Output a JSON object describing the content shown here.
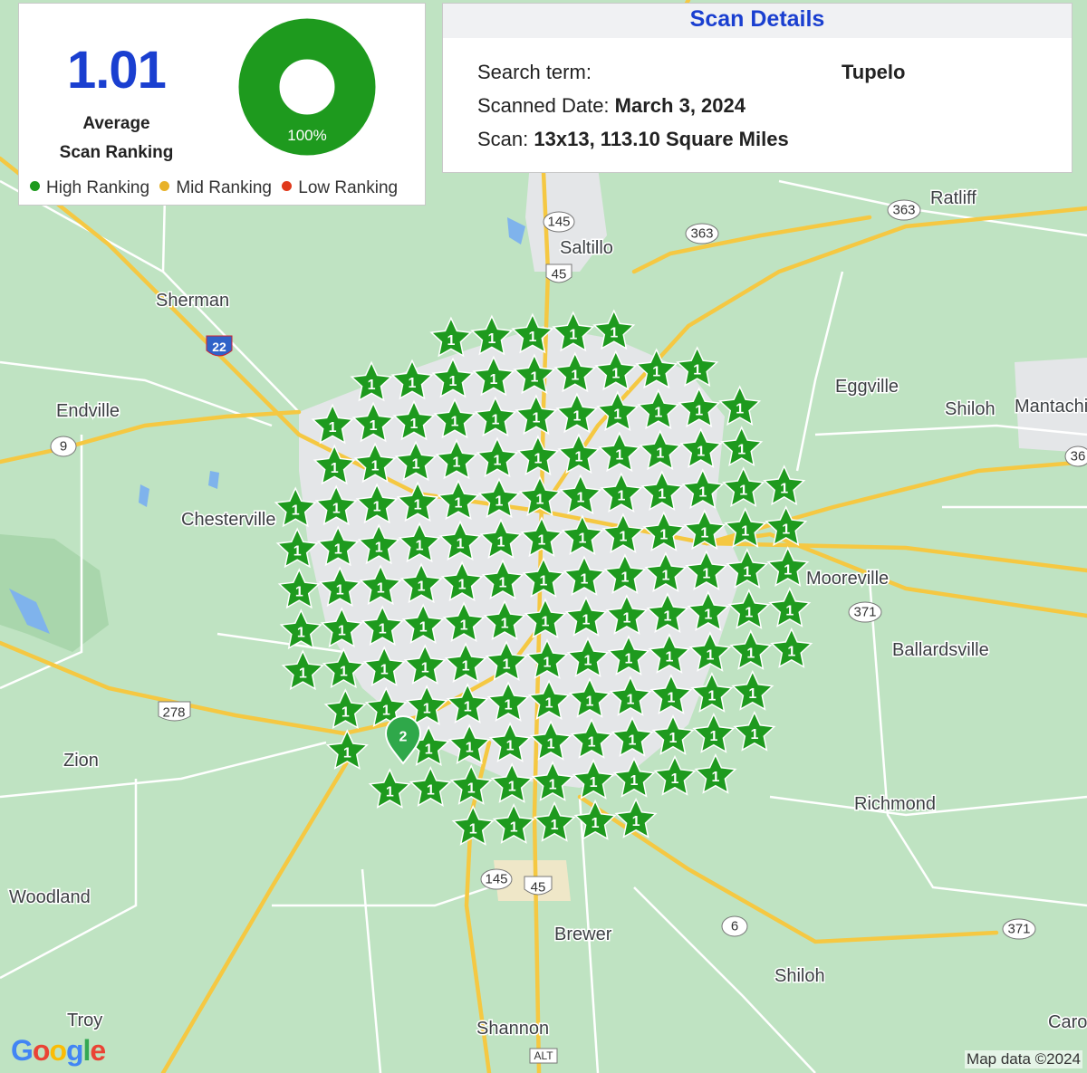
{
  "summary": {
    "average_value": "1.01",
    "average_label_line1": "Average",
    "average_label_line2": "Scan Ranking",
    "donut_percent": "100%",
    "donut_fraction": 1.0,
    "legend": [
      {
        "label": "High Ranking",
        "color": "#1e9a1e"
      },
      {
        "label": "Mid Ranking",
        "color": "#e8b22a"
      },
      {
        "label": "Low Ranking",
        "color": "#e0391b"
      }
    ]
  },
  "details": {
    "title": "Scan Details",
    "search_term_label": "Search term:",
    "search_term_value": "Tupelo",
    "date_label": "Scanned Date:",
    "date_value": "March 3, 2024",
    "scan_label": "Scan:",
    "scan_value": "13x13, 113.10 Square Miles"
  },
  "map": {
    "places": [
      "Sherman",
      "Endville",
      "Chesterville",
      "Saltillo",
      "Ratliff",
      "Eggville",
      "Shiloh",
      "Mantachie",
      "Mooreville",
      "Ballardsville",
      "Richmond",
      "Zion",
      "Woodland",
      "Troy",
      "Brewer",
      "Shiloh",
      "Shannon",
      "Caro"
    ],
    "route_shields": [
      "145",
      "45",
      "363",
      "363",
      "22",
      "9",
      "278",
      "371",
      "145",
      "45",
      "6",
      "371",
      "ALT",
      "36"
    ],
    "rank_marker_value": "1",
    "pin_value": "2",
    "colors": {
      "high": "#1e9a1e",
      "road_major": "#f5c842",
      "road_minor": "#ffffff",
      "water": "#7fb3ec",
      "urban": "#e4e6e8"
    }
  },
  "attribution": {
    "logo": "Google",
    "map_data": "Map data ©2024"
  }
}
